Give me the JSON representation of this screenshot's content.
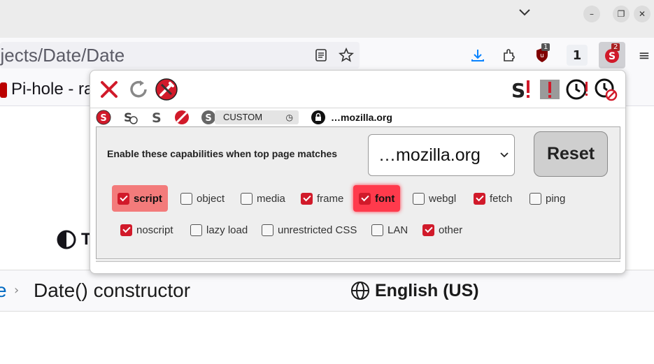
{
  "browser": {
    "url_text": "ojects/Date/Date",
    "bookmark_label": "Pi-hole - ra",
    "badge_ublock": "1",
    "badge_noscript": "2",
    "ext_number": "1"
  },
  "page": {
    "theme_label": "T",
    "breadcrumb_end": "e",
    "breadcrumb_sep": "›",
    "title": "Date() constructor",
    "language": "English (US)"
  },
  "popup": {
    "custom_label": "CUSTOM",
    "site_label": "…mozilla.org",
    "enable_label": "Enable these capabilities when top page matches",
    "select_value": "…mozilla.org",
    "reset_label": "Reset",
    "capabilities": [
      {
        "label": "script",
        "checked": true
      },
      {
        "label": "object",
        "checked": false
      },
      {
        "label": "media",
        "checked": false
      },
      {
        "label": "frame",
        "checked": true
      },
      {
        "label": "font",
        "checked": true
      },
      {
        "label": "webgl",
        "checked": false
      },
      {
        "label": "fetch",
        "checked": true
      },
      {
        "label": "ping",
        "checked": false
      },
      {
        "label": "noscript",
        "checked": true
      },
      {
        "label": "lazy load",
        "checked": false
      },
      {
        "label": "unrestricted CSS",
        "checked": false
      },
      {
        "label": "LAN",
        "checked": false
      },
      {
        "label": "other",
        "checked": true
      }
    ]
  },
  "colors": {
    "accent_red": "#d11a2a",
    "script_highlight": "#f37b7b",
    "font_highlight": "#ff3a4c"
  }
}
